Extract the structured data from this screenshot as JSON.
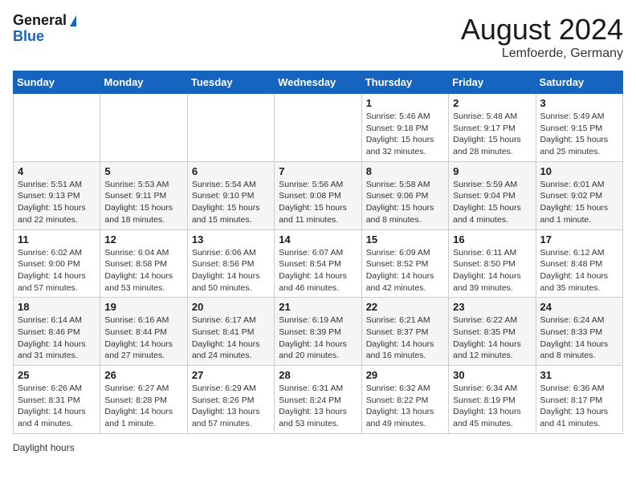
{
  "logo": {
    "line1": "General",
    "line2": "Blue"
  },
  "title": "August 2024",
  "subtitle": "Lemfoerde, Germany",
  "days_of_week": [
    "Sunday",
    "Monday",
    "Tuesday",
    "Wednesday",
    "Thursday",
    "Friday",
    "Saturday"
  ],
  "weeks": [
    [
      {
        "day": "",
        "info": ""
      },
      {
        "day": "",
        "info": ""
      },
      {
        "day": "",
        "info": ""
      },
      {
        "day": "",
        "info": ""
      },
      {
        "day": "1",
        "info": "Sunrise: 5:46 AM\nSunset: 9:18 PM\nDaylight: 15 hours\nand 32 minutes."
      },
      {
        "day": "2",
        "info": "Sunrise: 5:48 AM\nSunset: 9:17 PM\nDaylight: 15 hours\nand 28 minutes."
      },
      {
        "day": "3",
        "info": "Sunrise: 5:49 AM\nSunset: 9:15 PM\nDaylight: 15 hours\nand 25 minutes."
      }
    ],
    [
      {
        "day": "4",
        "info": "Sunrise: 5:51 AM\nSunset: 9:13 PM\nDaylight: 15 hours\nand 22 minutes."
      },
      {
        "day": "5",
        "info": "Sunrise: 5:53 AM\nSunset: 9:11 PM\nDaylight: 15 hours\nand 18 minutes."
      },
      {
        "day": "6",
        "info": "Sunrise: 5:54 AM\nSunset: 9:10 PM\nDaylight: 15 hours\nand 15 minutes."
      },
      {
        "day": "7",
        "info": "Sunrise: 5:56 AM\nSunset: 9:08 PM\nDaylight: 15 hours\nand 11 minutes."
      },
      {
        "day": "8",
        "info": "Sunrise: 5:58 AM\nSunset: 9:06 PM\nDaylight: 15 hours\nand 8 minutes."
      },
      {
        "day": "9",
        "info": "Sunrise: 5:59 AM\nSunset: 9:04 PM\nDaylight: 15 hours\nand 4 minutes."
      },
      {
        "day": "10",
        "info": "Sunrise: 6:01 AM\nSunset: 9:02 PM\nDaylight: 15 hours\nand 1 minute."
      }
    ],
    [
      {
        "day": "11",
        "info": "Sunrise: 6:02 AM\nSunset: 9:00 PM\nDaylight: 14 hours\nand 57 minutes."
      },
      {
        "day": "12",
        "info": "Sunrise: 6:04 AM\nSunset: 8:58 PM\nDaylight: 14 hours\nand 53 minutes."
      },
      {
        "day": "13",
        "info": "Sunrise: 6:06 AM\nSunset: 8:56 PM\nDaylight: 14 hours\nand 50 minutes."
      },
      {
        "day": "14",
        "info": "Sunrise: 6:07 AM\nSunset: 8:54 PM\nDaylight: 14 hours\nand 46 minutes."
      },
      {
        "day": "15",
        "info": "Sunrise: 6:09 AM\nSunset: 8:52 PM\nDaylight: 14 hours\nand 42 minutes."
      },
      {
        "day": "16",
        "info": "Sunrise: 6:11 AM\nSunset: 8:50 PM\nDaylight: 14 hours\nand 39 minutes."
      },
      {
        "day": "17",
        "info": "Sunrise: 6:12 AM\nSunset: 8:48 PM\nDaylight: 14 hours\nand 35 minutes."
      }
    ],
    [
      {
        "day": "18",
        "info": "Sunrise: 6:14 AM\nSunset: 8:46 PM\nDaylight: 14 hours\nand 31 minutes."
      },
      {
        "day": "19",
        "info": "Sunrise: 6:16 AM\nSunset: 8:44 PM\nDaylight: 14 hours\nand 27 minutes."
      },
      {
        "day": "20",
        "info": "Sunrise: 6:17 AM\nSunset: 8:41 PM\nDaylight: 14 hours\nand 24 minutes."
      },
      {
        "day": "21",
        "info": "Sunrise: 6:19 AM\nSunset: 8:39 PM\nDaylight: 14 hours\nand 20 minutes."
      },
      {
        "day": "22",
        "info": "Sunrise: 6:21 AM\nSunset: 8:37 PM\nDaylight: 14 hours\nand 16 minutes."
      },
      {
        "day": "23",
        "info": "Sunrise: 6:22 AM\nSunset: 8:35 PM\nDaylight: 14 hours\nand 12 minutes."
      },
      {
        "day": "24",
        "info": "Sunrise: 6:24 AM\nSunset: 8:33 PM\nDaylight: 14 hours\nand 8 minutes."
      }
    ],
    [
      {
        "day": "25",
        "info": "Sunrise: 6:26 AM\nSunset: 8:31 PM\nDaylight: 14 hours\nand 4 minutes."
      },
      {
        "day": "26",
        "info": "Sunrise: 6:27 AM\nSunset: 8:28 PM\nDaylight: 14 hours\nand 1 minute."
      },
      {
        "day": "27",
        "info": "Sunrise: 6:29 AM\nSunset: 8:26 PM\nDaylight: 13 hours\nand 57 minutes."
      },
      {
        "day": "28",
        "info": "Sunrise: 6:31 AM\nSunset: 8:24 PM\nDaylight: 13 hours\nand 53 minutes."
      },
      {
        "day": "29",
        "info": "Sunrise: 6:32 AM\nSunset: 8:22 PM\nDaylight: 13 hours\nand 49 minutes."
      },
      {
        "day": "30",
        "info": "Sunrise: 6:34 AM\nSunset: 8:19 PM\nDaylight: 13 hours\nand 45 minutes."
      },
      {
        "day": "31",
        "info": "Sunrise: 6:36 AM\nSunset: 8:17 PM\nDaylight: 13 hours\nand 41 minutes."
      }
    ]
  ],
  "footer": {
    "daylight_label": "Daylight hours"
  }
}
